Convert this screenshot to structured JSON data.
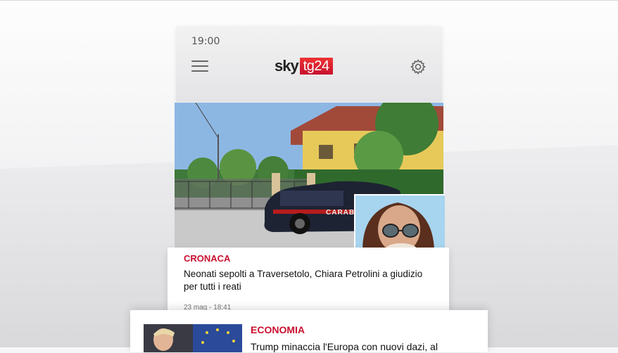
{
  "status_bar": {
    "time": "19:00"
  },
  "header": {
    "logo_sky": "sky",
    "logo_tg": "tg24"
  },
  "icons": {
    "menu": "hamburger-menu-icon",
    "settings": "gear-icon"
  },
  "articles": [
    {
      "category": "CRONACA",
      "headline": "Neonati sepolti a Traversetolo, Chiara Petrolini a giudizio per tutti i reati",
      "date": "23 mag - 18:41",
      "image_text": "CARABI"
    },
    {
      "category": "ECONOMIA",
      "headline": "Trump minaccia l'Europa con nuovi dazi, al"
    }
  ],
  "colors": {
    "accent": "#c8102e",
    "header_bg": "#e8e8ea"
  }
}
